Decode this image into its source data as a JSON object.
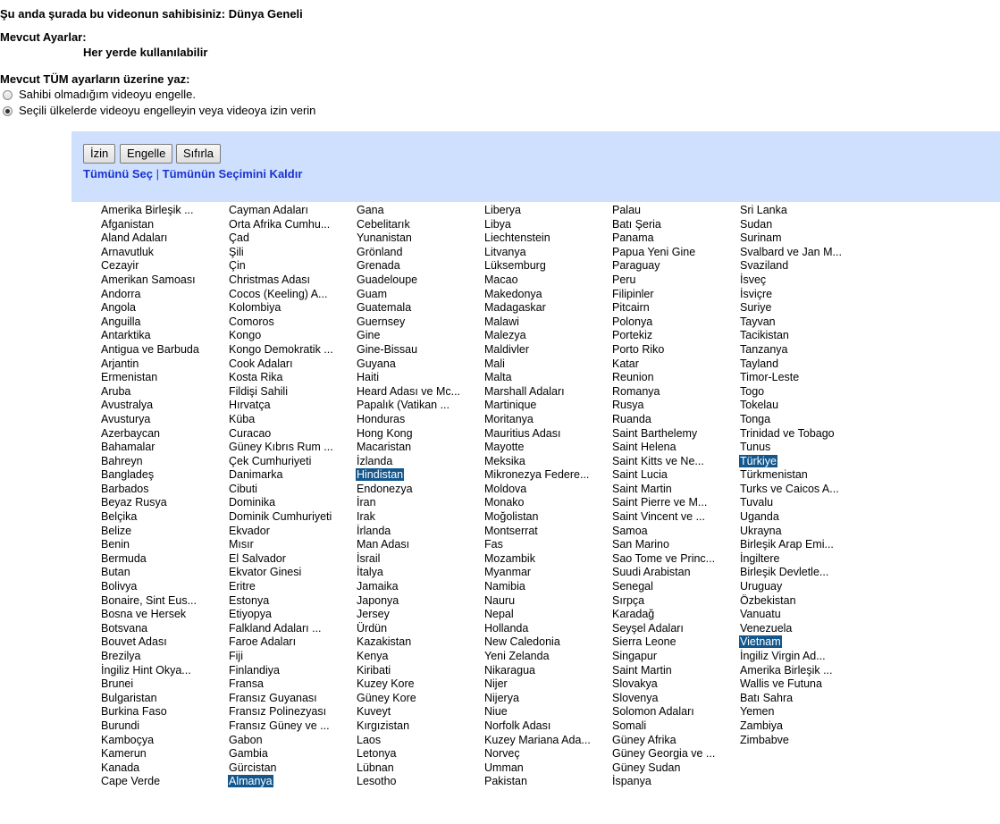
{
  "header": {
    "ownership": "Şu anda şurada bu videonun sahibisiniz: Dünya Geneli",
    "current_label": "Mevcut Ayarlar:",
    "current_value": "Her yerde kullanılabilir",
    "override_label": "Mevcut TÜM ayarların üzerine yaz:"
  },
  "options": [
    {
      "label": "Sahibi olmadığım videoyu engelle.",
      "checked": false
    },
    {
      "label": "Seçili ülkelerde videoyu engelleyin veya videoya izin verin",
      "checked": true
    }
  ],
  "toolbar": {
    "allow_label": "İzin",
    "block_label": "Engelle",
    "reset_label": "Sıfırla",
    "select_all": "Tümünü Seç",
    "separator": "|",
    "deselect_all": "Tümünün Seçimini Kaldır"
  },
  "countries": [
    [
      "Amerika Birleşik ...",
      "Afganistan",
      "Aland Adaları",
      "Arnavutluk",
      "Cezayir",
      "Amerikan Samoası",
      "Andorra",
      "Angola",
      "Anguilla",
      "Antarktika",
      "Antigua ve Barbuda",
      "Arjantin",
      "Ermenistan",
      "Aruba",
      "Avustralya",
      "Avusturya",
      "Azerbaycan",
      "Bahamalar",
      "Bahreyn",
      "Bangladeş",
      "Barbados",
      "Beyaz Rusya",
      "Belçika",
      "Belize",
      "Benin",
      "Bermuda",
      "Butan",
      "Bolivya",
      "Bonaire, Sint Eus...",
      "Bosna ve Hersek",
      "Botsvana",
      "Bouvet Adası",
      "Brezilya",
      "İngiliz Hint Okya...",
      "Brunei",
      "Bulgaristan",
      "Burkina Faso",
      "Burundi",
      "Kamboçya",
      "Kamerun",
      "Kanada",
      "Cape Verde"
    ],
    [
      "Cayman Adaları",
      "Orta Afrika Cumhu...",
      "Çad",
      "Şili",
      "Çin",
      "Christmas Adası",
      "Cocos (Keeling) A...",
      "Kolombiya",
      "Comoros",
      "Kongo",
      "Kongo Demokratik ...",
      "Cook Adaları",
      "Kosta Rika",
      "Fildişi Sahili",
      "Hırvatça",
      "Küba",
      "Curacao",
      "Güney Kıbrıs Rum ...",
      "Çek Cumhuriyeti",
      "Danimarka",
      "Cibuti",
      "Dominika",
      "Dominik Cumhuriyeti",
      "Ekvador",
      "Mısır",
      "El Salvador",
      "Ekvator Ginesi",
      "Eritre",
      "Estonya",
      "Etiyopya",
      "Falkland Adaları ...",
      "Faroe Adaları",
      "Fiji",
      "Finlandiya",
      "Fransa",
      "Fransız Guyanası",
      "Fransız Polinezyası",
      "Fransız Güney ve ...",
      "Gabon",
      "Gambia",
      "Gürcistan",
      "Almanya"
    ],
    [
      "Gana",
      "Cebelitarık",
      "Yunanistan",
      "Grönland",
      "Grenada",
      "Guadeloupe",
      "Guam",
      "Guatemala",
      "Guernsey",
      "Gine",
      "Gine-Bissau",
      "Guyana",
      "Haiti",
      "Heard Adası ve Mc...",
      "Papalık (Vatikan ...",
      "Honduras",
      "Hong Kong",
      "Macaristan",
      "İzlanda",
      "Hindistan",
      "Endonezya",
      "İran",
      "Irak",
      "İrlanda",
      "Man Adası",
      "İsrail",
      "İtalya",
      "Jamaika",
      "Japonya",
      "Jersey",
      "Ürdün",
      "Kazakistan",
      "Kenya",
      "Kiribati",
      "Kuzey Kore",
      "Güney Kore",
      "Kuveyt",
      "Kırgızistan",
      "Laos",
      "Letonya",
      "Lübnan",
      "Lesotho"
    ],
    [
      "Liberya",
      "Libya",
      "Liechtenstein",
      "Litvanya",
      "Lüksemburg",
      "Macao",
      "Makedonya",
      "Madagaskar",
      "Malawi",
      "Malezya",
      "Maldivler",
      "Mali",
      "Malta",
      "Marshall Adaları",
      "Martinique",
      "Moritanya",
      "Mauritius Adası",
      "Mayotte",
      "Meksika",
      "Mikronezya Federe...",
      "Moldova",
      "Monako",
      "Moğolistan",
      "Montserrat",
      "Fas",
      "Mozambik",
      "Myanmar",
      "Namibia",
      "Nauru",
      "Nepal",
      "Hollanda",
      "New Caledonia",
      "Yeni Zelanda",
      "Nikaragua",
      "Nijer",
      "Nijerya",
      "Niue",
      "Norfolk Adası",
      "Kuzey Mariana Ada...",
      "Norveç",
      "Umman",
      "Pakistan"
    ],
    [
      "Palau",
      "Batı Şeria",
      "Panama",
      "Papua Yeni Gine",
      "Paraguay",
      "Peru",
      "Filipinler",
      "Pitcairn",
      "Polonya",
      "Portekiz",
      "Porto Riko",
      "Katar",
      "Reunion",
      "Romanya",
      "Rusya",
      "Ruanda",
      "Saint Barthelemy",
      "Saint Helena",
      "Saint Kitts ve Ne...",
      "Saint Lucia",
      "Saint Martin",
      "Saint Pierre ve M...",
      "Saint Vincent ve ...",
      "Samoa",
      "San Marino",
      "Sao Tome ve Princ...",
      "Suudi Arabistan",
      "Senegal",
      "Sırpça",
      "Karadağ",
      "Seyşel Adaları",
      "Sierra Leone",
      "Singapur",
      "Saint Martin",
      "Slovakya",
      "Slovenya",
      "Solomon Adaları",
      "Somali",
      "Güney Afrika",
      "Güney Georgia ve ...",
      "Güney Sudan",
      "İspanya"
    ],
    [
      "Sri Lanka",
      "Sudan",
      "Surinam",
      "Svalbard ve Jan M...",
      "Svaziland",
      "İsveç",
      "İsviçre",
      "Suriye",
      "Tayvan",
      "Tacikistan",
      "Tanzanya",
      "Tayland",
      "Timor-Leste",
      "Togo",
      "Tokelau",
      "Tonga",
      "Trinidad ve Tobago",
      "Tunus",
      "Türkiye",
      "Türkmenistan",
      "Turks ve Caicos A...",
      "Tuvalu",
      "Uganda",
      "Ukrayna",
      "Birleşik Arap Emi...",
      "İngiltere",
      "Birleşik Devletle...",
      "Uruguay",
      "Özbekistan",
      "Vanuatu",
      "Venezuela",
      "Vietnam",
      "İngiliz Virgin Ad...",
      "Amerika Birleşik ...",
      "Wallis ve Futuna",
      "Batı Sahra",
      "Yemen",
      "Zambiya",
      "Zimbabve"
    ]
  ],
  "selected": [
    "Almanya",
    "Hindistan",
    "Türkiye",
    "Vietnam"
  ]
}
